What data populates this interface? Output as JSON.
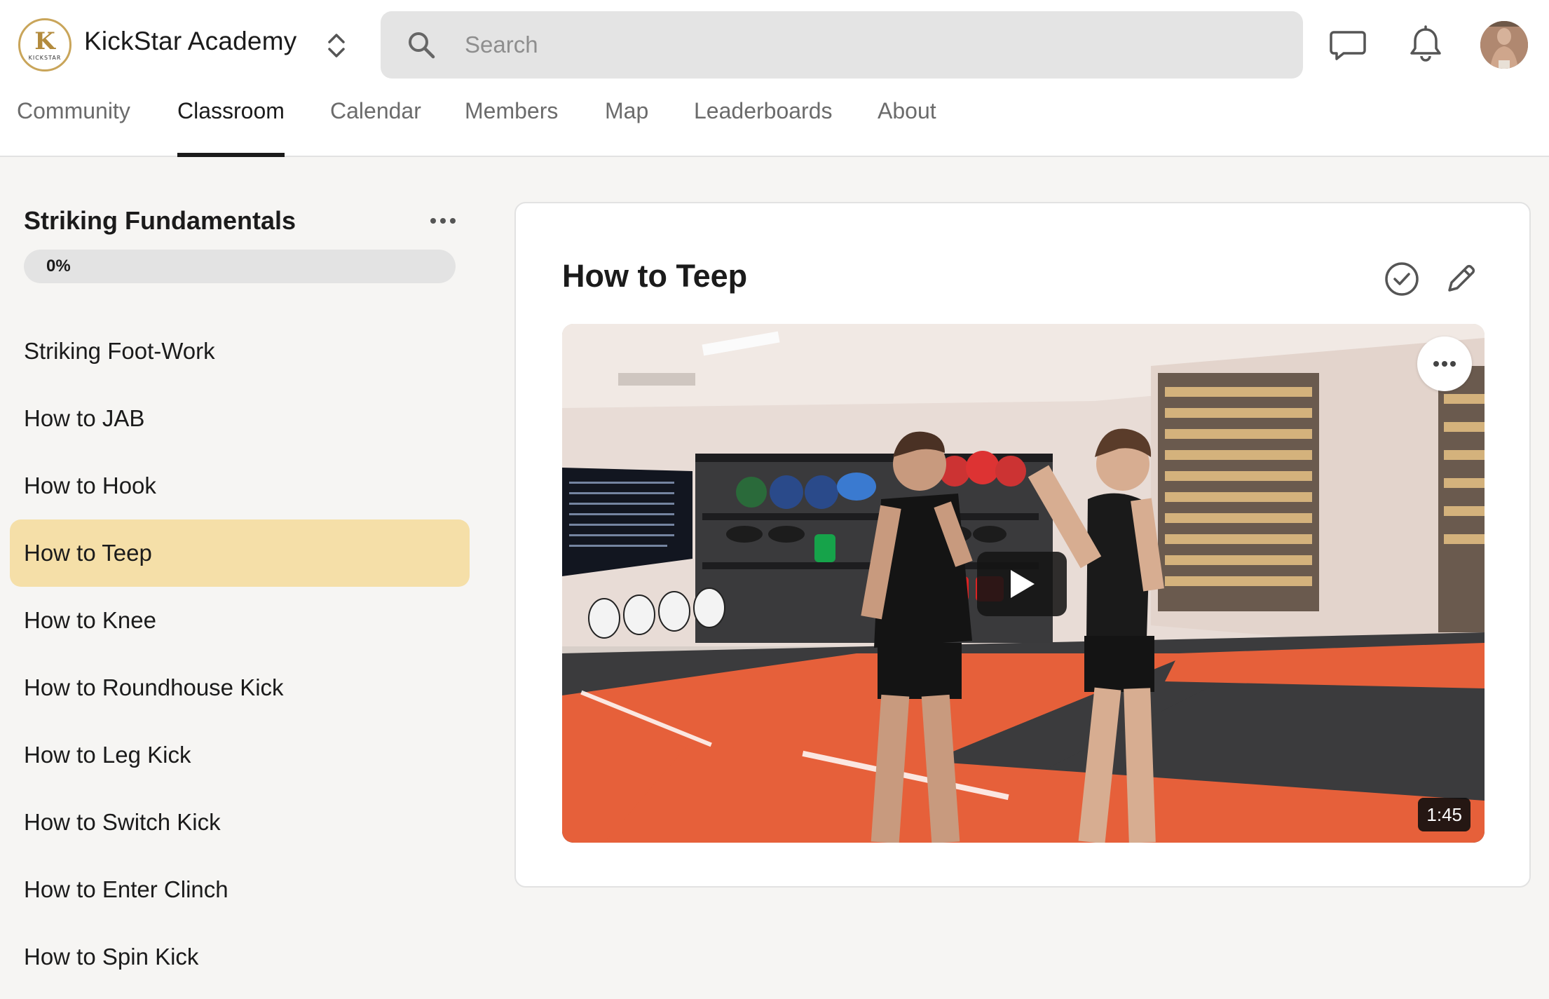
{
  "app": {
    "name": "KickStar Academy",
    "logo_text": "KICKSTAR"
  },
  "search": {
    "placeholder": "Search"
  },
  "tabs": [
    {
      "label": "Community"
    },
    {
      "label": "Classroom",
      "active": true
    },
    {
      "label": "Calendar"
    },
    {
      "label": "Members"
    },
    {
      "label": "Map"
    },
    {
      "label": "Leaderboards"
    },
    {
      "label": "About"
    }
  ],
  "header_icons": [
    "chat-icon",
    "bell-icon",
    "avatar"
  ],
  "course": {
    "title": "Striking Fundamentals",
    "progress_label": "0%",
    "progress_value": 0,
    "lessons": [
      {
        "label": "Striking Foot-Work"
      },
      {
        "label": "How to JAB"
      },
      {
        "label": "How to Hook"
      },
      {
        "label": "How to Teep",
        "active": true
      },
      {
        "label": "How to Knee"
      },
      {
        "label": "How to Roundhouse Kick"
      },
      {
        "label": "How to Leg Kick"
      },
      {
        "label": "How to Switch Kick"
      },
      {
        "label": "How to Enter Clinch"
      },
      {
        "label": "How to Spin Kick"
      }
    ]
  },
  "lesson": {
    "title": "How to Teep",
    "video": {
      "duration": "1:45"
    }
  },
  "colors": {
    "accent": "#c9a55a",
    "active_lesson_bg": "#f5dfa8",
    "page_bg": "#f6f5f3",
    "search_bg": "#e4e4e4"
  }
}
